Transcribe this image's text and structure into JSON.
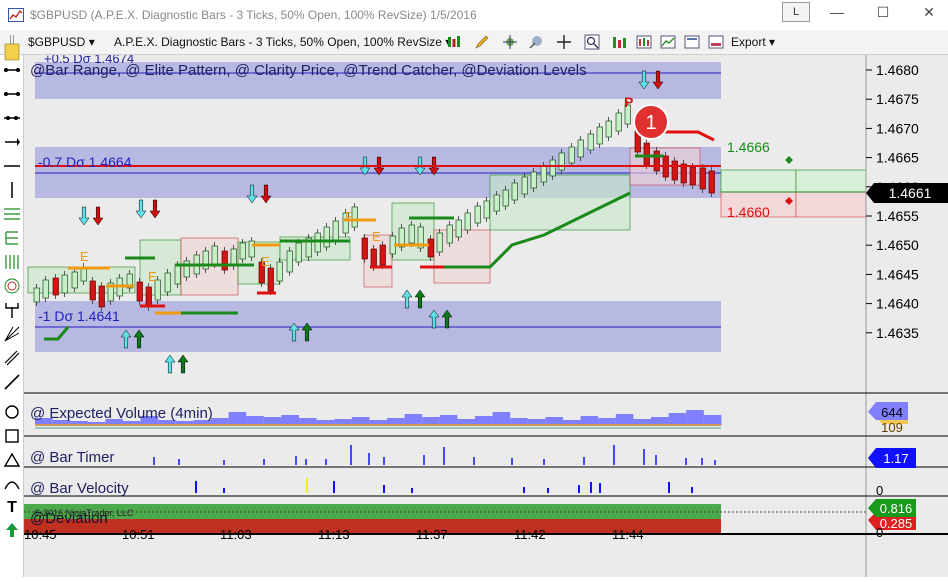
{
  "window": {
    "title": "$GBPUSD (A.P.E.X. Diagnostic Bars - 3 Ticks, 50% Open, 100% RevSize)  1/5/2016",
    "layout_button": "L",
    "minimize": "—",
    "maximize": "☐",
    "close": "✕"
  },
  "toolbar": {
    "instrument": "$GBPUSD",
    "bar_type": "A.P.E.X. Diagnostic Bars - 3 Ticks, 50% Open, 100% RevSize",
    "export_label": "Export"
  },
  "price_panel": {
    "indicators_title": "@Bar Range, @ Elite Pattern, @ Clarity Price, @Trend Catcher, @Deviation Levels",
    "top_label": "+0.5 Dσ 1.4674",
    "dev_upper_label": "-0.7 Dσ 1.4664",
    "dev_lower_label": "-1 Dσ 1.4641",
    "target_high": "1.4666",
    "target_low": "1.4660",
    "current_price": "1.4661",
    "marker_p": "P",
    "marker_e": "E",
    "badge_number": "1",
    "y_ticks": [
      "1.4680",
      "1.4675",
      "1.4670",
      "1.4665",
      "1.4660",
      "1.4655",
      "1.4650",
      "1.4645",
      "1.4640",
      "1.4635"
    ]
  },
  "volume_panel": {
    "title": "@ Expected Volume (4min)",
    "value_top": "644",
    "value_bottom": "109"
  },
  "timer_panel": {
    "title": "@ Bar Timer",
    "value": "1.17"
  },
  "velocity_panel": {
    "title": "@ Bar Velocity",
    "zero": "0"
  },
  "deviation_panel": {
    "title": "@Deviation",
    "copyright": "© 2016 NinjaTrader, LLC",
    "value_top": "0.816",
    "value_bottom": "0.285",
    "zero": "0"
  },
  "x_axis": {
    "labels": [
      "10:45",
      "10:51",
      "11:03",
      "11:13",
      "11:37",
      "11:42",
      "11:44"
    ]
  },
  "colors": {
    "chart_bg": "#ebebeb",
    "deviation_band": "#b7b9e3",
    "bar_up": "#c8f0c8",
    "bar_down": "#d11515",
    "clarity_green": "#0a8a0a",
    "current_price_bg": "#000000",
    "timer_badge": "#1010ff",
    "volume_bar": "#8080ff",
    "badge_red": "#e03030"
  }
}
